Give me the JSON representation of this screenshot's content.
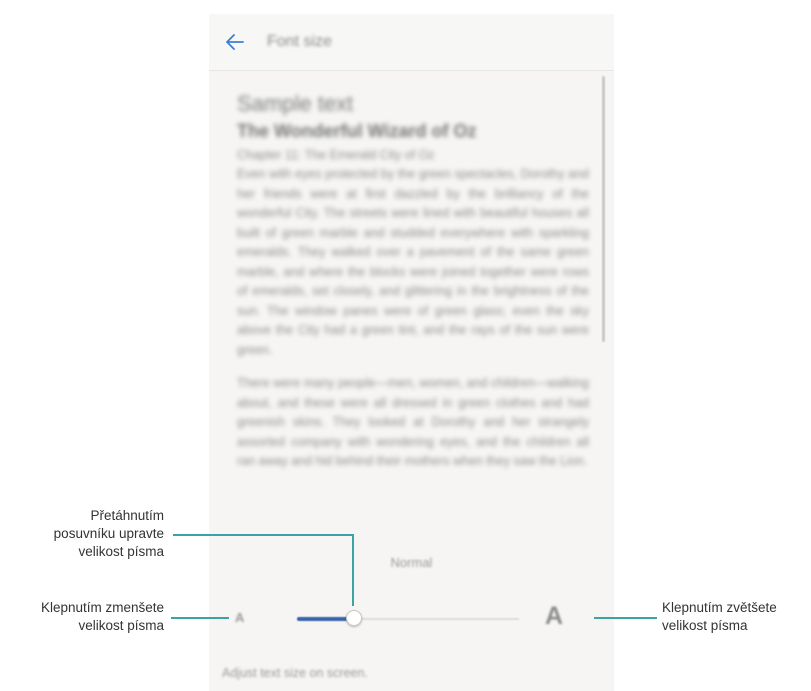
{
  "screen": {
    "header": {
      "title": "Font size"
    },
    "preview": {
      "sample_label": "Sample text",
      "book_title": "The Wonderful Wizard of Oz",
      "chapter": "Chapter 11: The Emerald City of Oz",
      "paragraph1": "Even with eyes protected by the green spectacles, Dorothy and her friends were at first dazzled by the brilliancy of the wonderful City. The streets were lined with beautiful houses all built of green marble and studded everywhere with sparkling emeralds. They walked over a pavement of the same green marble, and where the blocks were joined together were rows of emeralds, set closely, and glittering in the brightness of the sun. The window panes were of green glass; even the sky above the City had a green tint, and the rays of the sun were green.",
      "paragraph2": "There were many people—men, women, and children—walking about, and these were all dressed in green clothes and had greenish skins. They looked at Dorothy and her strangely assorted company with wondering eyes, and the children all ran away and hid behind their mothers when they saw the Lion."
    },
    "size_name": "Normal",
    "slider": {
      "value_fraction": 0.25
    },
    "small_a": "A",
    "large_a": "A",
    "footer": "Adjust text size on screen."
  },
  "callouts": {
    "drag_slider": [
      "Přetáhnutím",
      "posuvníku upravte",
      "velikost písma"
    ],
    "decrease": [
      "Klepnutím zmenšete",
      "velikost písma"
    ],
    "increase": [
      "Klepnutím zvětšete",
      "velikost písma"
    ]
  },
  "colors": {
    "callout_line": "#3aa3a6",
    "back_arrow": "#3c7fd4",
    "slider_fill": "#3a63a8"
  },
  "icons": {
    "back": "back-arrow-icon"
  }
}
